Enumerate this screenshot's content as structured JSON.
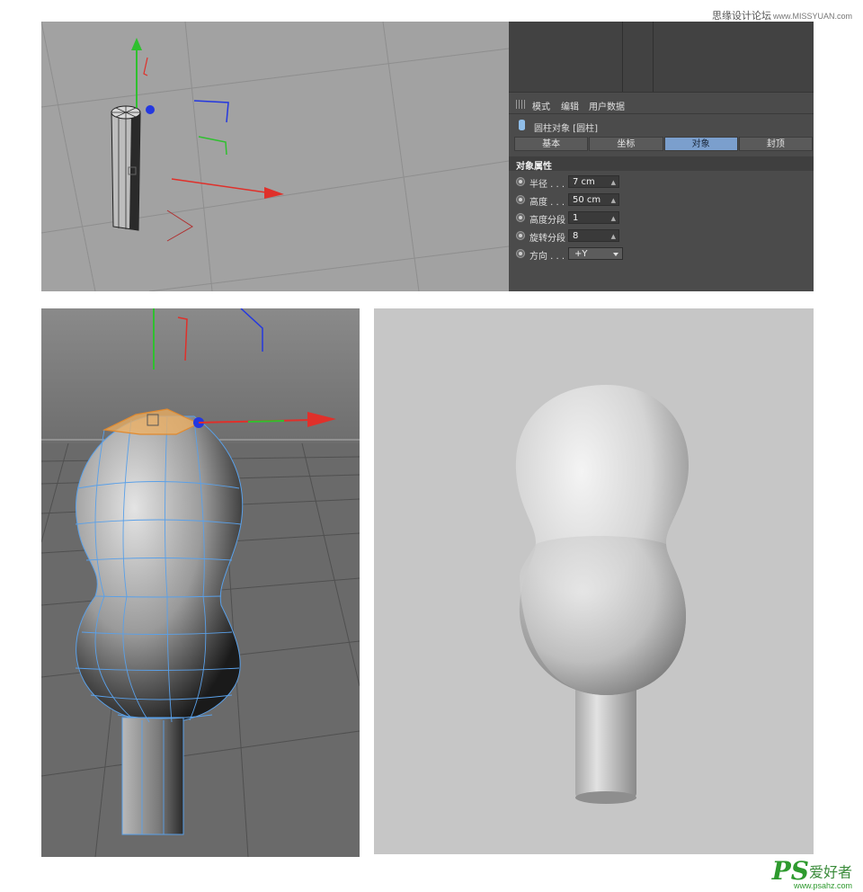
{
  "watermark": {
    "top_text": "思缘设计论坛",
    "top_site": "www.MISSYUAN.com",
    "logo_ps": "PS",
    "logo_cn": "爱好者",
    "logo_url": "www.psahz.com"
  },
  "attribute_manager": {
    "menus": [
      "模式",
      "编辑",
      "用户数据"
    ],
    "object_title": "圆柱对象 [圆柱]",
    "tabs": [
      "基本",
      "坐标",
      "对象",
      "封顶"
    ],
    "active_tab": "对象",
    "section_title": "对象属性",
    "params": [
      {
        "label": "半径 . . .",
        "value": "7 cm"
      },
      {
        "label": "高度 . . .",
        "value": "50 cm"
      },
      {
        "label": "高度分段",
        "value": "1"
      },
      {
        "label": "旋转分段",
        "value": "8"
      },
      {
        "label": "方向 . . .",
        "value": "+Y"
      }
    ]
  },
  "colors": {
    "axis_x": "#e0302a",
    "axis_y": "#2fc02f",
    "axis_z": "#2438e0",
    "mesh_wire": "#5aa0e8",
    "selection": "#f0a040",
    "active_tab": "#7b9fcd"
  }
}
